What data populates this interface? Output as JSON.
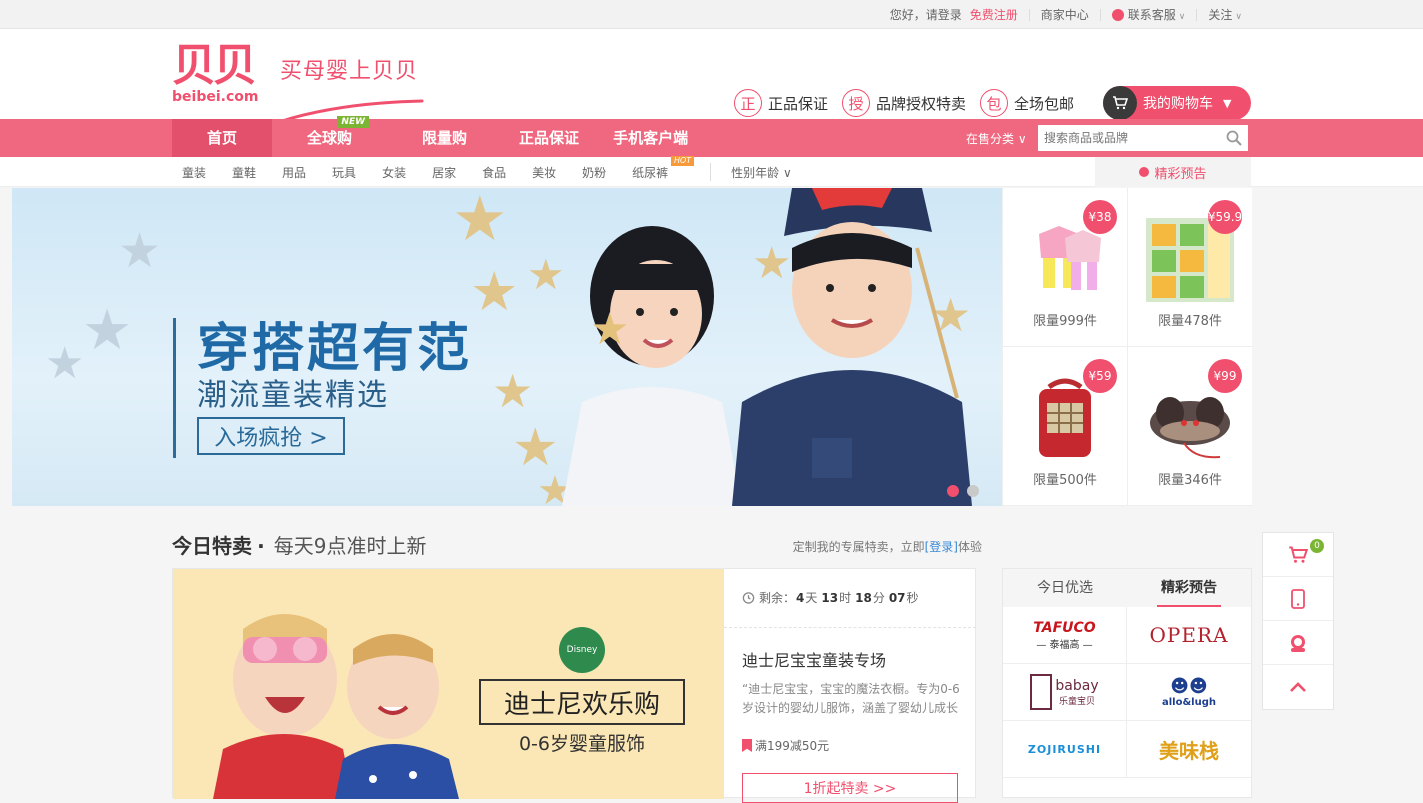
{
  "topbar": {
    "greeting": "您好，请登录",
    "register": "免费注册",
    "merchant": "商家中心",
    "service": "联系客服",
    "follow": "关注"
  },
  "header": {
    "logo_mark": "贝贝",
    "logo_domain": "beibei.com",
    "slogan": "买母婴上贝贝",
    "promises": [
      {
        "icon": "正",
        "label": "正品保证"
      },
      {
        "icon": "授",
        "label": "品牌授权特卖"
      },
      {
        "icon": "包",
        "label": "全场包邮"
      }
    ],
    "cart_label": "我的购物车"
  },
  "nav": {
    "items": [
      {
        "label": "首页"
      },
      {
        "label": "全球购",
        "badge": "NEW"
      },
      {
        "label": "限量购"
      },
      {
        "label": "正品保证"
      },
      {
        "label": "手机客户端"
      }
    ],
    "category_select": "在售分类",
    "search_placeholder": "搜索商品或品牌"
  },
  "subnav": {
    "categories": [
      "童装",
      "童鞋",
      "用品",
      "玩具",
      "女装",
      "居家",
      "食品",
      "美妆",
      "奶粉",
      "纸尿裤"
    ],
    "hot_badge": "HOT",
    "age_select": "性别年龄",
    "preview": "精彩预告"
  },
  "banner": {
    "headline": "穿搭超有范",
    "subline": "潮流童装精选",
    "cta": "入场疯抢 >"
  },
  "limited": [
    {
      "price": "¥38",
      "qty": "限量999件"
    },
    {
      "price": "¥59.9",
      "qty": "限量478件"
    },
    {
      "price": "¥59",
      "qty": "限量500件"
    },
    {
      "price": "¥99",
      "qty": "限量346件"
    }
  ],
  "today": {
    "title": "今日特卖",
    "dot": "·",
    "subtitle": "每天9点准时上新",
    "note_prefix": "定制我的专属特卖，立即",
    "note_link": "[登录]",
    "note_suffix": "体验"
  },
  "deal": {
    "box_text": "迪士尼欢乐购",
    "sub_text": "0-6岁婴童服饰",
    "logo_text": "Disney",
    "timer_label": "剩余：",
    "days": "4",
    "hours": "13",
    "minutes": "18",
    "seconds": "07",
    "u_day": "天",
    "u_hour": "时",
    "u_min": "分",
    "u_sec": "秒",
    "title": "迪士尼宝宝童装专场",
    "desc": "“迪士尼宝宝，宝宝的魔法衣橱。专为0-6岁设计的婴幼儿服饰，涵盖了婴幼儿成长",
    "promo": "满199减50元",
    "go": "1折起特卖 >>"
  },
  "brands": {
    "tabs": [
      "今日优选",
      "精彩预告"
    ],
    "items": [
      {
        "name": "TAFUCO",
        "sub": "— 泰福高 —"
      },
      {
        "name": "OPERA",
        "sub": ""
      },
      {
        "name": "babay",
        "sub": "乐童宝贝"
      },
      {
        "name": "allo&lugh",
        "sub": ""
      },
      {
        "name": "ZOJIRUSHI",
        "sub": ""
      },
      {
        "name": "美味栈",
        "sub": ""
      }
    ]
  },
  "floatbar": {
    "cart_count": "0"
  },
  "colors": {
    "brand_pink": "#f0506e",
    "nav_pink": "#f0687f",
    "badge_green": "#7cb534"
  }
}
